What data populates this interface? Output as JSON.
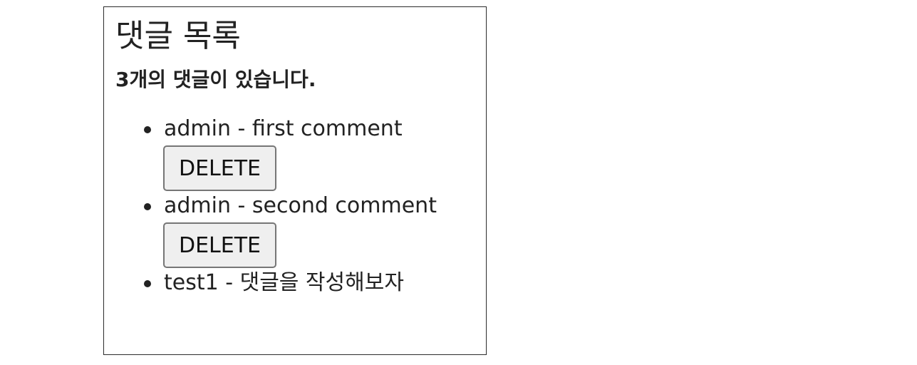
{
  "page": {
    "title": "댓글 목록",
    "count_text": "3개의 댓글이 있습니다."
  },
  "comments": [
    {
      "text": "admin - first comment",
      "delete_label": "DELETE"
    },
    {
      "text": "admin - second comment",
      "delete_label": "DELETE"
    },
    {
      "text": "test1 - 댓글을 작성해보자"
    }
  ]
}
